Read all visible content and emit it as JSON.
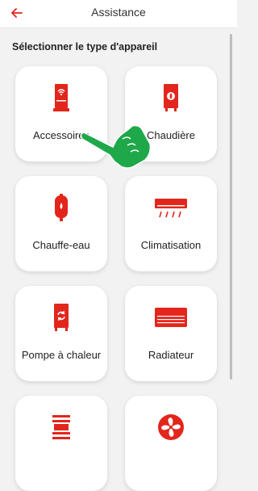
{
  "header": {
    "title": "Assistance",
    "back_icon": "arrow-left-icon"
  },
  "section": {
    "title": "Sélectionner le type d'appareil"
  },
  "colors": {
    "accent": "#e2261c",
    "pointer": "#1fa84a"
  },
  "devices": [
    {
      "label": "Accessoires",
      "icon": "wifi-thermostat-icon"
    },
    {
      "label": "Chaudière",
      "icon": "boiler-icon"
    },
    {
      "label": "Chauffe-eau",
      "icon": "water-heater-icon"
    },
    {
      "label": "Climatisation",
      "icon": "air-conditioner-icon"
    },
    {
      "label": "Pompe à chaleur",
      "icon": "heat-pump-icon"
    },
    {
      "label": "Radiateur",
      "icon": "radiator-icon"
    },
    {
      "label": "",
      "icon": "towel-radiator-icon"
    },
    {
      "label": "",
      "icon": "fan-icon"
    }
  ]
}
